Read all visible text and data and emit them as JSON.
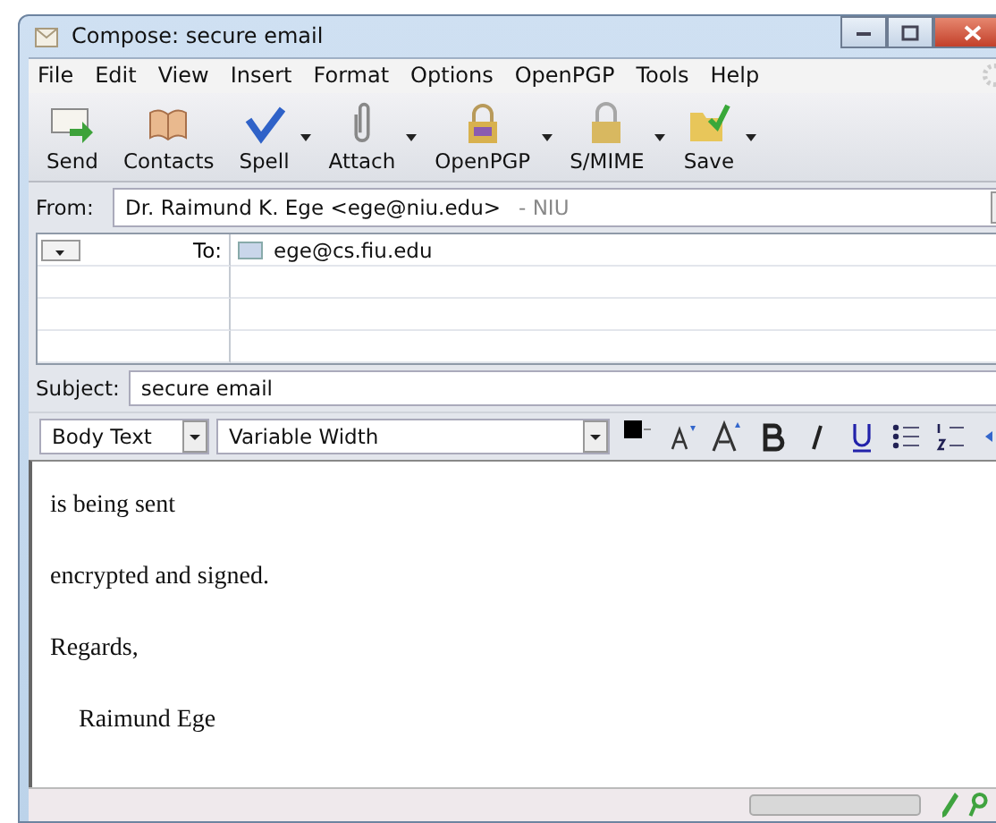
{
  "window": {
    "title": "Compose: secure email"
  },
  "menu": [
    "File",
    "Edit",
    "View",
    "Insert",
    "Format",
    "Options",
    "OpenPGP",
    "Tools",
    "Help"
  ],
  "toolbar": [
    {
      "kind": "send",
      "label": "Send",
      "has_menu": false
    },
    {
      "kind": "contacts",
      "label": "Contacts",
      "has_menu": false
    },
    {
      "kind": "spell",
      "label": "Spell",
      "has_menu": true
    },
    {
      "kind": "attach",
      "label": "Attach",
      "has_menu": true
    },
    {
      "kind": "openpgp",
      "label": "OpenPGP",
      "has_menu": true
    },
    {
      "kind": "smime",
      "label": "S/MIME",
      "has_menu": true
    },
    {
      "kind": "save",
      "label": "Save",
      "has_menu": true
    }
  ],
  "from": {
    "label": "From:",
    "name": "Dr. Raimund K. Ege <ege@niu.edu>",
    "account": "- NIU"
  },
  "recipients": [
    {
      "type": "To:",
      "address": "ege@cs.fiu.edu"
    }
  ],
  "subject": {
    "label": "Subject:",
    "value": "secure email"
  },
  "format_bar": {
    "paragraph_style": "Body Text",
    "font": "Variable Width"
  },
  "body": [
    "is being sent",
    "encrypted and signed.",
    "Regards,",
    "Raimund Ege"
  ]
}
